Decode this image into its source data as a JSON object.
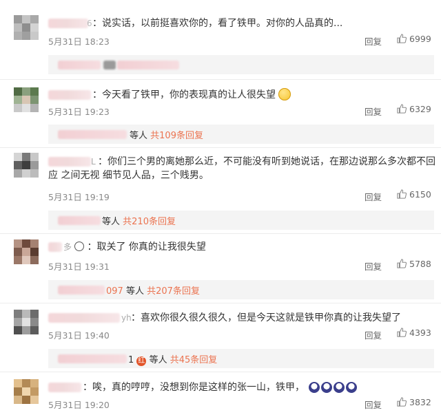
{
  "comments": [
    {
      "text": "：说实话，以前挺喜欢你的，看了铁甲。对你的人品真的...",
      "time": "5月31日 18:23",
      "reply": "回复",
      "likes": "6999"
    },
    {
      "text": "：今天看了铁甲，你的表现真的让人很失望",
      "time": "5月31日 19:23",
      "reply": "回复",
      "likes": "6329",
      "emoji": "smile-emoji"
    },
    {
      "text": "：你们三个男的离她那么近，不可能没有听到她说话，在那边说那么多次都不回应 之间无视 细节见人品，三个贱男。",
      "time": "5月31日 19:19",
      "reply": "回复",
      "likes": "6150"
    },
    {
      "text": "：取关了 你真的让我很失望",
      "time": "5月31日 19:31",
      "reply": "回复",
      "likes": "5788",
      "emoji": "panda-emoji"
    },
    {
      "text": "：喜欢你很久很久很久，但是今天这就是铁甲你真的让我失望了",
      "time": "5月31日 19:40",
      "reply": "回复",
      "likes": "4393"
    },
    {
      "text": "：唉，真的哼哼，没想到你是这样的张一山，铁甲，",
      "time": "5月31日 19:20",
      "reply": "回复",
      "likes": "3832",
      "emoji": "crying-emoji"
    }
  ],
  "name_fragments": {
    "c1": "6",
    "c3": "L",
    "c4": "多",
    "c5": "yh"
  },
  "subreplies": [
    {
      "prefix": "",
      "who": "等人",
      "count": "共109条回复"
    },
    {
      "prefix": "",
      "who": "等人",
      "count": "共210条回复"
    },
    {
      "prefix": "097",
      "who": "等人",
      "count": "共207条回复"
    },
    {
      "prefix": "1",
      "badge": "红",
      "who": "等人",
      "count": "共45条回复"
    }
  ],
  "colors": {
    "accent": "#eb7350",
    "text": "#333333",
    "meta": "#888888"
  },
  "icons": {
    "like": "thumbs-up-icon"
  }
}
